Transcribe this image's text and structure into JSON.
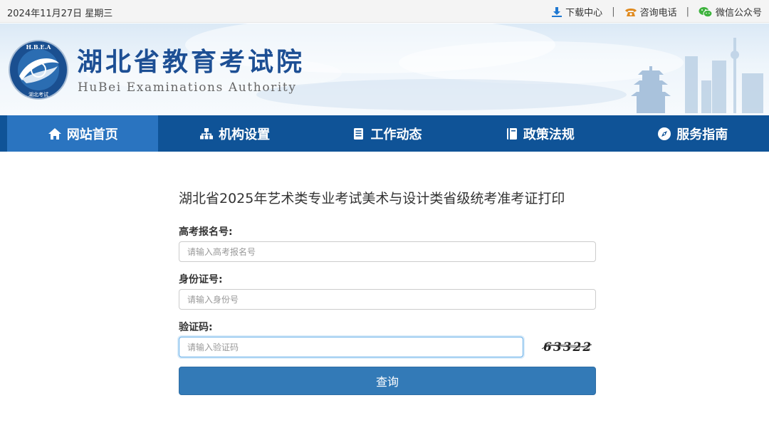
{
  "topbar": {
    "date": "2024年11月27日 星期三",
    "links": [
      {
        "label": "下载中心",
        "icon": "download-icon",
        "color": "#1f78d1"
      },
      {
        "label": "咨询电话",
        "icon": "phone-icon",
        "color": "#e08a1e"
      },
      {
        "label": "微信公众号",
        "icon": "wechat-icon",
        "color": "#3fb33f"
      }
    ],
    "separator": "|"
  },
  "banner": {
    "logo_text": "H.B.E.A",
    "logo_sub": "湖北考试",
    "title_cn": "湖北省教育考试院",
    "title_en": "HuBei Examinations Authority"
  },
  "nav": {
    "items": [
      {
        "label": "网站首页",
        "icon": "home-icon"
      },
      {
        "label": "机构设置",
        "icon": "sitemap-icon"
      },
      {
        "label": "工作动态",
        "icon": "document-icon"
      },
      {
        "label": "政策法规",
        "icon": "book-icon"
      },
      {
        "label": "服务指南",
        "icon": "compass-icon"
      }
    ],
    "active_index": 0,
    "bg_color": "#0f5397",
    "active_color": "#2a74c0"
  },
  "form": {
    "title": "湖北省2025年艺术类专业考试美术与设计类省级统考准考证打印",
    "exam_no": {
      "label": "高考报名号:",
      "placeholder": "请输入高考报名号",
      "value": ""
    },
    "id_no": {
      "label": "身份证号:",
      "placeholder": "请输入身份号",
      "value": ""
    },
    "captcha": {
      "label": "验证码:",
      "placeholder": "请输入验证码",
      "value": "",
      "image_text": "63322"
    },
    "submit_label": "查询",
    "button_color": "#337ab7"
  }
}
